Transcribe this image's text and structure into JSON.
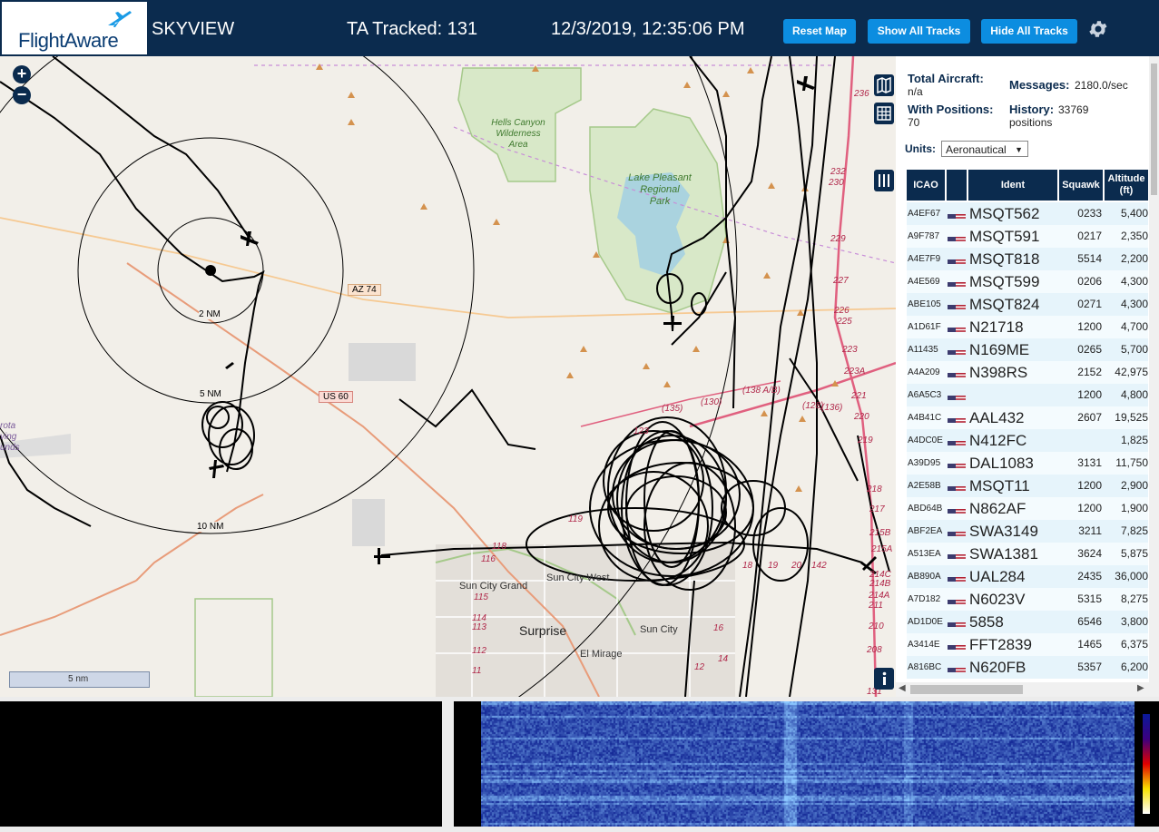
{
  "header": {
    "logo_text": "FlightAware",
    "app_name": "SKYVIEW",
    "tracked": "TA Tracked: 131",
    "datetime": "12/3/2019, 12:35:06 PM",
    "buttons": {
      "reset": "Reset Map",
      "show": "Show All Tracks",
      "hide": "Hide All Tracks"
    },
    "settings_icon": "gear-icon"
  },
  "map": {
    "labels": {
      "hells_canyon": [
        "Hells Canyon",
        "Wilderness",
        "Area"
      ],
      "lake_pleasant": [
        "Lake Pleasant",
        "Regional",
        "Park"
      ],
      "ring_2": "2 NM",
      "ring_5": "5 NM",
      "ring_10": "10 NM",
      "az74": "AZ 74",
      "us60": "US 60",
      "sun_city_grand": "Sun City Grand",
      "sun_city_west": "Sun City West",
      "surprise": "Surprise",
      "el_mirage": "El Mirage",
      "sun_city": "Sun City",
      "proving": [
        "rota",
        "ving",
        "unds"
      ],
      "exits": [
        "236",
        "232",
        "230",
        "229",
        "227",
        "226",
        "225",
        "223",
        "223A",
        "221",
        "220",
        "219",
        "218",
        "217",
        "215B",
        "215A",
        "214C",
        "214B",
        "214A",
        "211",
        "210",
        "208",
        "131",
        "(130)",
        "(135)",
        "(138 A/B)",
        "(136)",
        "(128)",
        "123",
        "119",
        "118",
        "116",
        "115",
        "114",
        "113",
        "112",
        "11",
        "12",
        "14",
        "16",
        "18",
        "19",
        "20",
        "142"
      ]
    },
    "scale": "5 nm",
    "controls": {
      "zoom_in": "+",
      "zoom_out": "−"
    }
  },
  "panel": {
    "total_aircraft_label": "Total Aircraft:",
    "total_aircraft_value": "n/a",
    "with_positions_label": "With Positions:",
    "with_positions_value": "70",
    "messages_label": "Messages:",
    "messages_value": "2180.0/sec",
    "history_label": "History:",
    "history_value": "33769",
    "history_unit": "positions",
    "units_label": "Units:",
    "units_value": "Aeronautical",
    "columns": {
      "icao": "ICAO",
      "ident": "Ident",
      "squawk": "Squawk",
      "altitude": "Altitude",
      "altitude_unit": "(ft)"
    },
    "rows": [
      {
        "icao": "A4EF67",
        "ident": "MSQT562",
        "squawk": "0233",
        "alt": "5,400"
      },
      {
        "icao": "A9F787",
        "ident": "MSQT591",
        "squawk": "0217",
        "alt": "2,350"
      },
      {
        "icao": "A4E7F9",
        "ident": "MSQT818",
        "squawk": "5514",
        "alt": "2,200"
      },
      {
        "icao": "A4E569",
        "ident": "MSQT599",
        "squawk": "0206",
        "alt": "4,300"
      },
      {
        "icao": "ABE105",
        "ident": "MSQT824",
        "squawk": "0271",
        "alt": "4,300"
      },
      {
        "icao": "A1D61F",
        "ident": "N21718",
        "squawk": "1200",
        "alt": "4,700"
      },
      {
        "icao": "A11435",
        "ident": "N169ME",
        "squawk": "0265",
        "alt": "5,700"
      },
      {
        "icao": "A4A209",
        "ident": "N398RS",
        "squawk": "2152",
        "alt": "42,975"
      },
      {
        "icao": "A6A5C3",
        "ident": "",
        "squawk": "1200",
        "alt": "4,800"
      },
      {
        "icao": "A4B41C",
        "ident": "AAL432",
        "squawk": "2607",
        "alt": "19,525"
      },
      {
        "icao": "A4DC0E",
        "ident": "N412FC",
        "squawk": "",
        "alt": "1,825"
      },
      {
        "icao": "A39D95",
        "ident": "DAL1083",
        "squawk": "3131",
        "alt": "11,750"
      },
      {
        "icao": "A2E58B",
        "ident": "MSQT11",
        "squawk": "1200",
        "alt": "2,900"
      },
      {
        "icao": "ABD64B",
        "ident": "N862AF",
        "squawk": "1200",
        "alt": "1,900"
      },
      {
        "icao": "ABF2EA",
        "ident": "SWA3149",
        "squawk": "3211",
        "alt": "7,825"
      },
      {
        "icao": "A513EA",
        "ident": "SWA1381",
        "squawk": "3624",
        "alt": "5,875"
      },
      {
        "icao": "AB890A",
        "ident": "UAL284",
        "squawk": "2435",
        "alt": "36,000"
      },
      {
        "icao": "A7D182",
        "ident": "N6023V",
        "squawk": "5315",
        "alt": "8,275"
      },
      {
        "icao": "AD1D0E",
        "ident": "5858",
        "squawk": "6546",
        "alt": "3,800"
      },
      {
        "icao": "A3414E",
        "ident": "FFT2839",
        "squawk": "1465",
        "alt": "6,375"
      },
      {
        "icao": "A816BC",
        "ident": "N620FB",
        "squawk": "5357",
        "alt": "6,200"
      }
    ]
  },
  "colors": {
    "header_bg": "#0b2b4e",
    "button_bg": "#0c8de0",
    "row_alt": "#e6f4fb",
    "track": "#000000"
  }
}
